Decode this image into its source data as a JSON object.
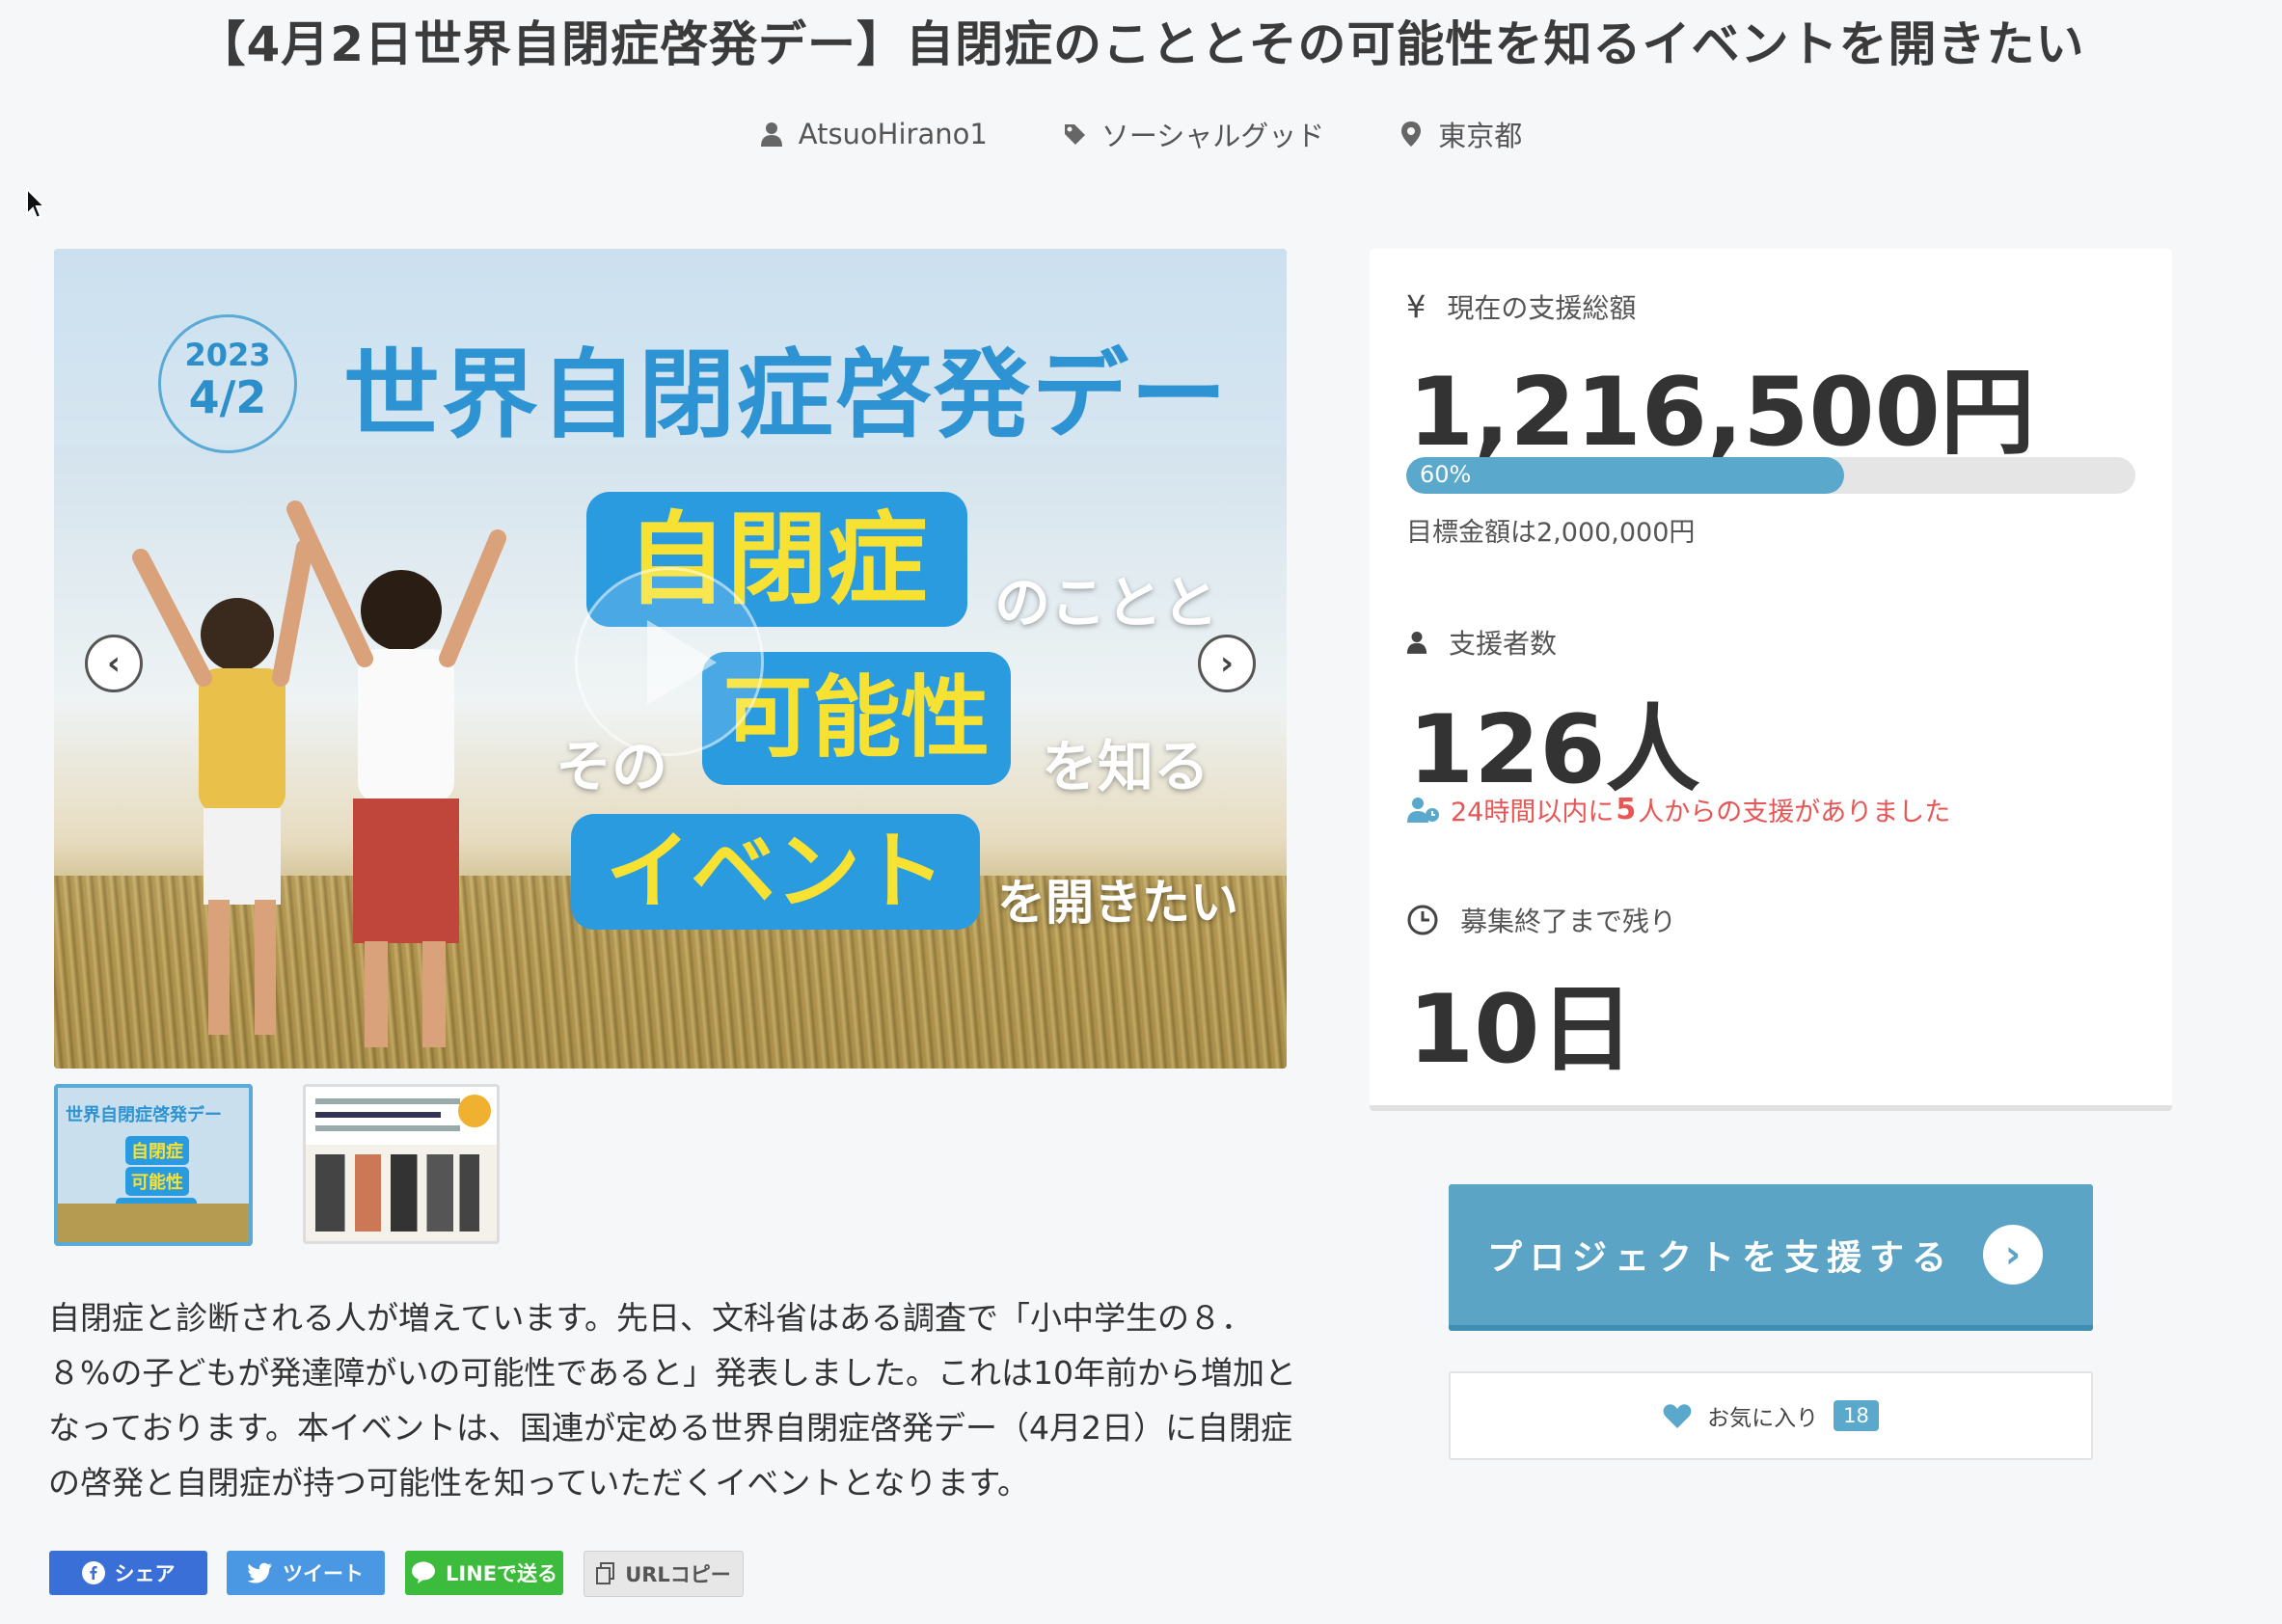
{
  "title": "【4月2日世界自閉症啓発デー】自閉症のこととその可能性を知るイベントを開きたい",
  "meta": {
    "author": "AtsuoHirano1",
    "category": "ソーシャルグッド",
    "location": "東京都"
  },
  "hero": {
    "date_year": "2023",
    "date_day": "4/2",
    "headline": "世界自閉症啓発デー",
    "pill_1": "自閉症",
    "text_1": "のことと",
    "text_2": "その",
    "pill_2": "可能性",
    "text_3": "を知る",
    "pill_3": "イベント",
    "text_4": "を開きたい",
    "prev_icon": "chevron-left",
    "next_icon": "chevron-right"
  },
  "thumbnails": {
    "thumb_1_head": "世界自閉症啓発デー",
    "thumb_1_pill_a": "自閉症",
    "thumb_1_pill_b": "可能性",
    "thumb_1_pill_c": "イベント"
  },
  "description": "自閉症と診断される人が増えています。先日、文科省はある調査で「小中学生の８．８%の子どもが発達障がいの可能性であると」発表しました。これは10年前から増加となっております。本イベントは、国連が定める世界自閉症啓発デー（4月2日）に自閉症の啓発と自閉症が持つ可能性を知っていただくイベントとなります。",
  "share": {
    "facebook": "シェア",
    "twitter": "ツイート",
    "line": "LINEで送る",
    "url": "URLコピー"
  },
  "stats": {
    "total_label": "現在の支援総額",
    "total_value": "1,216,500円",
    "progress_text": "60%",
    "progress_percent": 60,
    "goal_text": "目標金額は2,000,000円",
    "backers_label": "支援者数",
    "backers_value": "126人",
    "recent_prefix": "24時間以内に",
    "recent_count": "5",
    "recent_suffix": "人からの支援がありました",
    "remaining_label": "募集終了まで残り",
    "remaining_value": "10日"
  },
  "actions": {
    "support_label": "プロジェクトを支援する",
    "favorite_label": "お気に入り",
    "favorite_count": "18"
  },
  "colors": {
    "accent": "#5ba4c6",
    "alert": "#e85555",
    "facebook": "#3b6fd8",
    "twitter": "#4a98e4",
    "line": "#3dbb3d"
  }
}
